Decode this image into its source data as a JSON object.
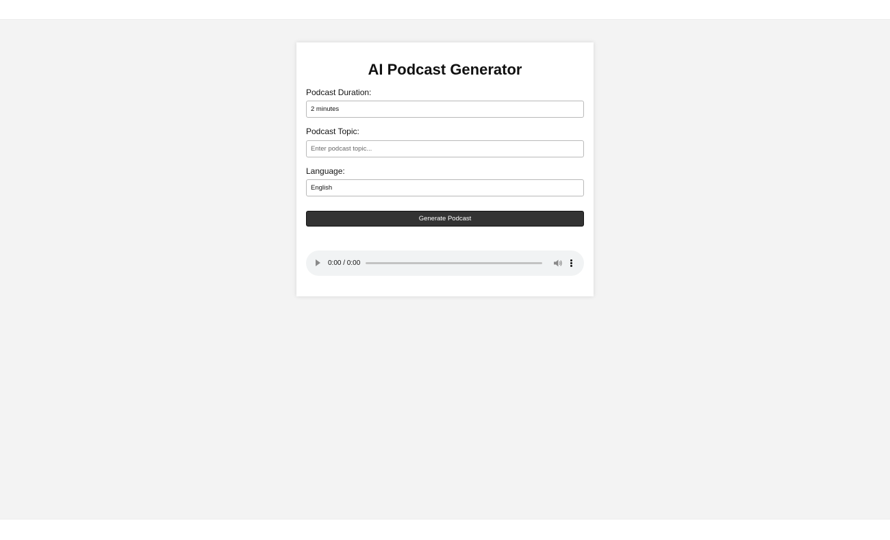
{
  "app": {
    "title": "AI Podcast Generator"
  },
  "form": {
    "duration": {
      "label": "Podcast Duration:",
      "value": "2 minutes"
    },
    "topic": {
      "label": "Podcast Topic:",
      "value": "",
      "placeholder": "Enter podcast topic..."
    },
    "language": {
      "label": "Language:",
      "value": "English"
    },
    "generate_label": "Generate Podcast"
  },
  "audio_player": {
    "time": "0:00 / 0:00",
    "progress": 0,
    "icons": {
      "play": "play-icon",
      "volume": "volume-icon",
      "menu": "more-vertical-icon"
    }
  },
  "colors": {
    "page_background": "#f3f3f3",
    "card_background": "#ffffff",
    "button_background": "#333333",
    "button_text": "#ffffff",
    "player_background": "#f1f3f4"
  }
}
